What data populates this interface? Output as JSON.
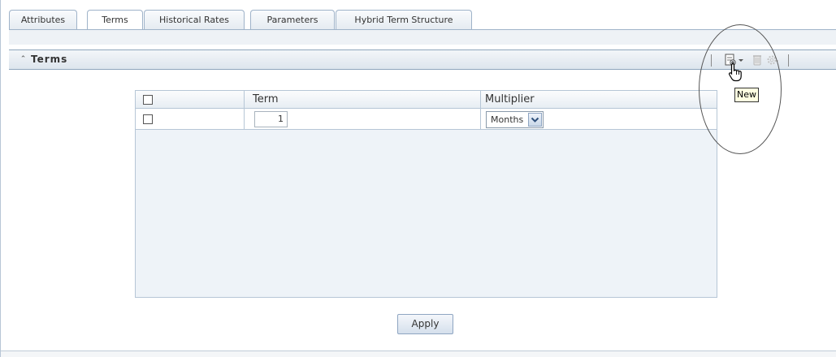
{
  "tabs": [
    {
      "label": "Attributes",
      "active": false
    },
    {
      "label": "Terms",
      "active": true
    },
    {
      "label": "Historical Rates",
      "active": false
    },
    {
      "label": "Parameters",
      "active": false
    },
    {
      "label": "Hybrid Term Structure",
      "active": false
    }
  ],
  "panel": {
    "title": "Terms",
    "collapse_icon": "double-chevron-up-icon",
    "toolbar": {
      "new_icon": "new-document-icon",
      "dropdown_icon": "chevron-down-icon",
      "delete_icon": "delete-icon",
      "settings_icon": "gear-icon"
    }
  },
  "grid": {
    "columns": [
      "Term",
      "Multiplier"
    ],
    "rows": [
      {
        "term": "1",
        "multiplier": "Months",
        "checked": false
      }
    ]
  },
  "apply_label": "Apply",
  "tooltip": "New",
  "colors": {
    "tab_border": "#9fb3c9",
    "header_bg": "#dde5ed",
    "grid_bg": "#eef3f8"
  }
}
